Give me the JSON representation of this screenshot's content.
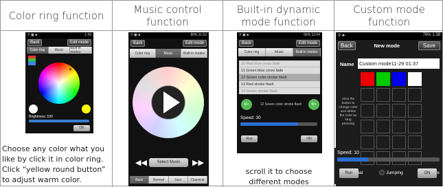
{
  "headers": [
    {
      "title": "Color ring function"
    },
    {
      "title": "Music control function"
    },
    {
      "title": "Built-in dynamic mode function"
    },
    {
      "title": "Custom mode function"
    }
  ],
  "status": {
    "p1_time": "1:43",
    "p2_time": "11:52",
    "p3_time": "12:04",
    "p4_time": "1:38",
    "p2_batt": "80%",
    "p3_batt": "65%",
    "p4_batt": "76%"
  },
  "common": {
    "back": "Back",
    "edit_mode": "Edit mode"
  },
  "tabs": [
    "Color ring",
    "Music",
    "Built-in modes"
  ],
  "panel1": {
    "brightness": "Brightness: 100",
    "ok": "OK",
    "caption": "Choose any color what you like by click it in color ring. Click “yellow round button” to adjust warm color."
  },
  "panel2": {
    "select_music": "Select Music",
    "eq_tabs": [
      "Back",
      "Normal",
      "Jazz",
      "Classical"
    ]
  },
  "panel3": {
    "modes": [
      "10 Red blue cross fade",
      "11 Green blue cross fade",
      "12 Seven color strobe flash",
      "13 Red strobe flash",
      "14 Green strobe flash"
    ],
    "minus": "M−",
    "plus": "M+",
    "current": "12 Seven color strobe flash",
    "speed": "Speed: 30",
    "run": "Run",
    "on": "ON",
    "caption": "scroll it to choose different modes"
  },
  "panel4": {
    "title": "New mode",
    "save": "Save",
    "name_label": "Name",
    "name_value": "Custom mode11-29 01:37",
    "hint": "Click the button to change color and delete the color by long pressing",
    "modes": [
      "Gradual",
      "Jumping",
      "Strobe"
    ],
    "speed": "Speed: 10",
    "run": "Run",
    "on": "ON"
  }
}
